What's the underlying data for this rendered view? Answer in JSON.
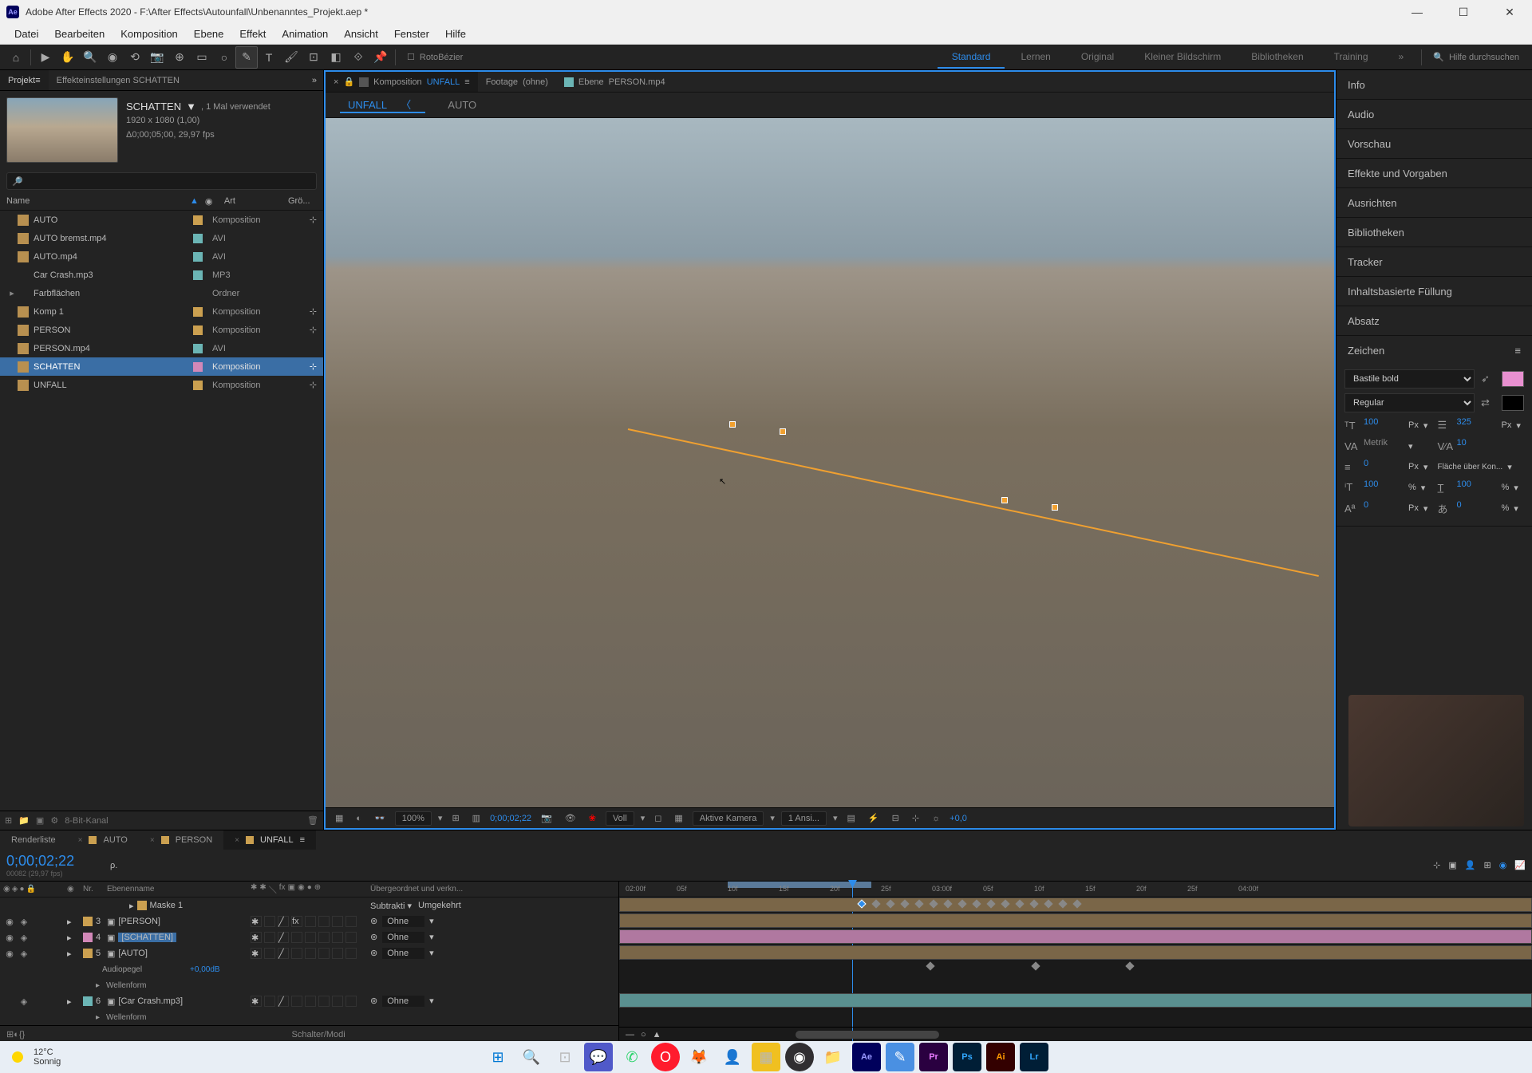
{
  "titlebar": {
    "app_icon": "Ae",
    "title": "Adobe After Effects 2020 - F:\\After Effects\\Autounfall\\Unbenanntes_Projekt.aep *"
  },
  "menubar": [
    "Datei",
    "Bearbeiten",
    "Komposition",
    "Ebene",
    "Effekt",
    "Animation",
    "Ansicht",
    "Fenster",
    "Hilfe"
  ],
  "toolbar": {
    "rotobezier": "RotoBézier",
    "workspaces": [
      "Standard",
      "Lernen",
      "Original",
      "Kleiner Bildschirm",
      "Bibliotheken",
      "Training"
    ],
    "active_workspace": 0,
    "search_placeholder": "Hilfe durchsuchen"
  },
  "left_panel": {
    "tabs": [
      "Projekt",
      "Effekteinstellungen SCHATTEN"
    ],
    "active_tab": 0,
    "selected_item": {
      "name": "SCHATTEN",
      "usage": ", 1 Mal verwendet",
      "resolution": "1920 x 1080 (1,00)",
      "duration": "Δ0;00;05;00, 29,97 fps"
    },
    "columns": {
      "name": "Name",
      "type": "Art",
      "size": "Grö..."
    },
    "items": [
      {
        "name": "AUTO",
        "type": "Komposition",
        "label": "sand",
        "icon": "comp"
      },
      {
        "name": "AUTO bremst.mp4",
        "type": "AVI",
        "label": "aqua",
        "icon": "avi"
      },
      {
        "name": "AUTO.mp4",
        "type": "AVI",
        "label": "aqua",
        "icon": "avi"
      },
      {
        "name": "Car Crash.mp3",
        "type": "MP3",
        "label": "aqua",
        "icon": "audio"
      },
      {
        "name": "Farbflächen",
        "type": "Ordner",
        "label": "none",
        "icon": "folder",
        "expander": true
      },
      {
        "name": "Komp 1",
        "type": "Komposition",
        "label": "sand",
        "icon": "comp"
      },
      {
        "name": "PERSON",
        "type": "Komposition",
        "label": "sand",
        "icon": "comp"
      },
      {
        "name": "PERSON.mp4",
        "type": "AVI",
        "label": "aqua",
        "icon": "avi"
      },
      {
        "name": "SCHATTEN",
        "type": "Komposition",
        "label": "pink",
        "icon": "comp",
        "selected": true
      },
      {
        "name": "UNFALL",
        "type": "Komposition",
        "label": "sand",
        "icon": "comp"
      }
    ],
    "footer": {
      "bpc": "8-Bit-Kanal"
    }
  },
  "viewer": {
    "tabs": [
      {
        "label": "Komposition",
        "sub": "UNFALL",
        "active": true
      },
      {
        "label": "Footage",
        "sub": "(ohne)"
      },
      {
        "label": "Ebene",
        "sub": "PERSON.mp4"
      }
    ],
    "nav_tabs": [
      "UNFALL",
      "AUTO"
    ],
    "active_nav": 0,
    "controls": {
      "zoom": "100%",
      "timecode": "0;00;02;22",
      "resolution": "Voll",
      "camera": "Aktive Kamera",
      "views": "1 Ansi...",
      "exposure": "+0,0"
    }
  },
  "right_panel": {
    "sections": [
      "Info",
      "Audio",
      "Vorschau",
      "Effekte und Vorgaben",
      "Ausrichten",
      "Bibliotheken",
      "Tracker",
      "Inhaltsbasierte Füllung",
      "Absatz"
    ],
    "char_header": "Zeichen",
    "char": {
      "font": "Bastile bold",
      "style": "Regular",
      "size": "100",
      "size_unit": "Px",
      "leading": "325",
      "leading_unit": "Px",
      "kerning": "Metrik",
      "tracking": "10",
      "stroke": "0",
      "stroke_unit": "Px",
      "fill_over": "Fläche über Kon...",
      "vscale": "100",
      "vscale_unit": "%",
      "hscale": "100",
      "hscale_unit": "%",
      "baseline": "0",
      "baseline_unit": "Px",
      "tsume": "0",
      "tsume_unit": "%"
    }
  },
  "timeline": {
    "tabs": [
      "Renderliste",
      "AUTO",
      "PERSON",
      "UNFALL"
    ],
    "active_tab": 3,
    "timecode": "0;00;02;22",
    "timecode_sub": "00082 (29,97 fps)",
    "columns": {
      "num": "Nr.",
      "name": "Ebenenname",
      "mode": "Subtrakti",
      "invert": "Umgekehrt",
      "parent": "Übergeordnet und verkn..."
    },
    "layers": [
      {
        "num": "",
        "name": "Maske 1",
        "color": "#cba050",
        "mode": "Subtrakti",
        "invert": "Umgekehrt",
        "sublevel": 1
      },
      {
        "num": "3",
        "name": "[PERSON]",
        "color": "#cba050",
        "parent": "Ohne",
        "eye": true,
        "audio": true,
        "fx": true,
        "lasso": true
      },
      {
        "num": "4",
        "name": "[SCHATTEN]",
        "color": "#d288b8",
        "parent": "Ohne",
        "eye": true,
        "audio": true,
        "selected": true,
        "lasso": true
      },
      {
        "num": "5",
        "name": "[AUTO]",
        "color": "#cba050",
        "parent": "Ohne",
        "eye": true,
        "audio": true,
        "lasso": true
      },
      {
        "num": "",
        "name": "Audiopegel",
        "value": "+0,00dB",
        "prop": true,
        "sublevel": 2
      },
      {
        "num": "",
        "name": "Wellenform",
        "prop": true,
        "sublevel": 2
      },
      {
        "num": "6",
        "name": "[Car Crash.mp3]",
        "color": "#6bb5b5",
        "parent": "Ohne",
        "audio": true,
        "lasso": true
      },
      {
        "num": "",
        "name": "Wellenform",
        "prop": true,
        "sublevel": 2
      }
    ],
    "ruler_marks": [
      "02:00f",
      "05f",
      "10f",
      "15f",
      "20f",
      "25f",
      "03:00f",
      "05f",
      "10f",
      "15f",
      "20f",
      "25f",
      "04:00f"
    ],
    "footer": "Schalter/Modi",
    "parent_none": "Ohne"
  },
  "taskbar": {
    "temp": "12°C",
    "condition": "Sonnig"
  }
}
